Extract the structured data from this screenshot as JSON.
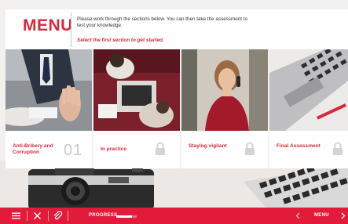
{
  "header": {
    "title": "MENU",
    "intro": "Please work through the sections below. You can then take the assessment to test your knowledge.",
    "prompt": "Select the first section to get started."
  },
  "sections": [
    {
      "label": "Anti-Bribery and Corruption",
      "number": "01",
      "state": "unlocked",
      "photo_icon": "handshake-refusal-photo"
    },
    {
      "label": "In practice",
      "state": "locked",
      "photo_icon": "meeting-photo"
    },
    {
      "label": "Staying vigilant",
      "state": "locked",
      "photo_icon": "woman-phone-photo"
    },
    {
      "label": "Final Assessment",
      "state": "locked",
      "photo_icon": "laptop-photo"
    }
  ],
  "bottom_bar": {
    "progress_label": "PROGRESS",
    "progress_fraction": 0.75,
    "menu_label": "MENU"
  },
  "colors": {
    "accent": "#d6293d",
    "bar": "#e21b3a"
  }
}
